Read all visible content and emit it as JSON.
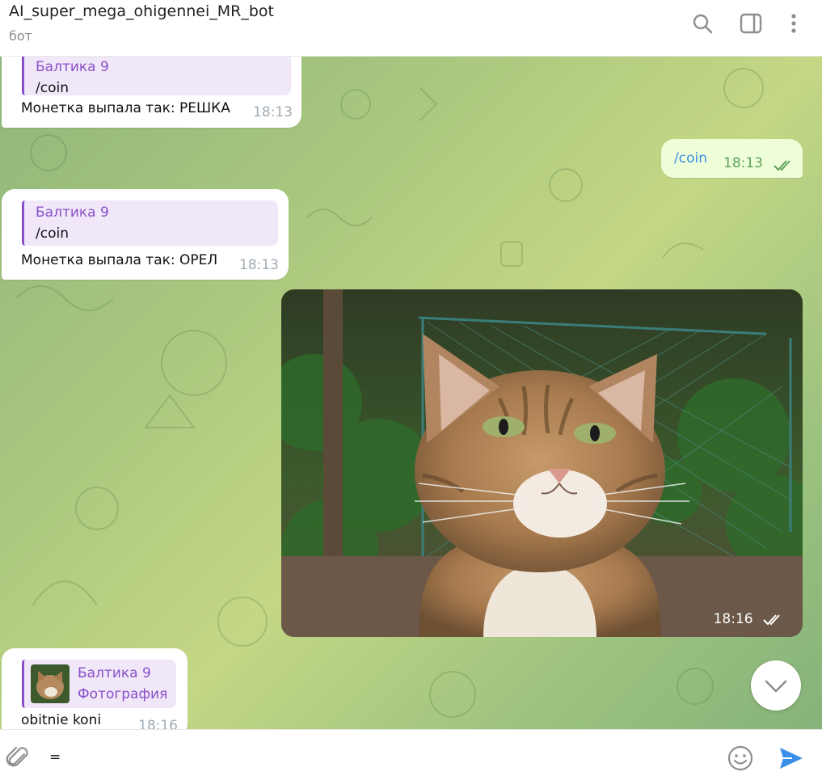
{
  "header": {
    "title": "AI_super_mega_ohigennei_MR_bot",
    "subtitle": "бот",
    "icons": [
      "search-icon",
      "sidebar-icon",
      "more-vert-icon"
    ]
  },
  "messages": [
    {
      "direction": "in",
      "reply_name": "Балтика 9",
      "reply_text": "/coin",
      "text": "Монетка выпала так: РЕШКА",
      "time": "18:13"
    },
    {
      "direction": "out",
      "text": "/coin",
      "time": "18:13",
      "status": "read-checks-icon"
    },
    {
      "direction": "in",
      "reply_name": "Балтика 9",
      "reply_text": "/coin",
      "text": "Монетка выпала так: ОРЕЛ",
      "time": "18:13"
    },
    {
      "direction": "out",
      "type": "photo",
      "time": "18:16",
      "status": "read-checks-icon"
    },
    {
      "direction": "in",
      "reply_name": "Балтика 9",
      "reply_text": "Фотография",
      "text": "obitnie koni",
      "time": "18:16"
    }
  ],
  "input": {
    "value": "="
  },
  "colors": {
    "accent": "#8a4fc9",
    "out_bubble": "#eefed9",
    "send": "#3a8ee6",
    "read_checks": "#5fa25b"
  }
}
